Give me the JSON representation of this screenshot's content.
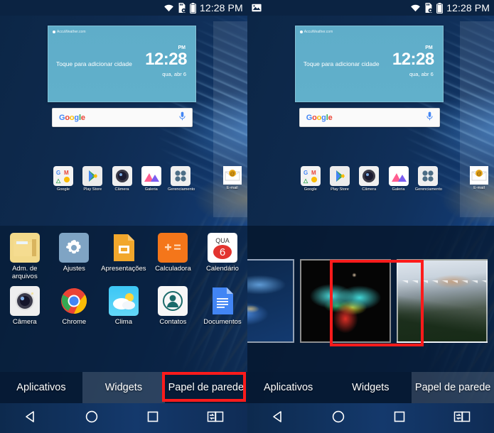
{
  "meta": {
    "accent_red": "#ff1b1b",
    "wallpaper_blue": "#10305b",
    "widget_blue": "#5fadc9"
  },
  "statusbar": {
    "time": "12:28 PM",
    "icons_right": [
      "wifi-icon",
      "sdcard-icon",
      "battery-icon"
    ],
    "icons_left_right_panel": [
      "image-notification-icon"
    ]
  },
  "home": {
    "weather_widget": {
      "provider": "AccuWeather.com",
      "prompt": "Toque para adicionar cidade",
      "ampm": "PM",
      "time": "12:28",
      "date": "qua, abr 6"
    },
    "search": {
      "logo": "Google",
      "mic_icon": "microphone-icon"
    },
    "dock": [
      {
        "label": "Google",
        "icon": "google-folder-icon"
      },
      {
        "label": "Play Store",
        "icon": "play-store-icon"
      },
      {
        "label": "Câmera",
        "icon": "camera-icon"
      },
      {
        "label": "Galeria",
        "icon": "gallery-icon"
      },
      {
        "label": "Gerenciamento",
        "icon": "management-folder-icon"
      }
    ],
    "side_app": {
      "label": "E-mail",
      "icon": "email-icon"
    }
  },
  "drawer": {
    "apps": [
      {
        "label": "Adm. de arquivos",
        "icon": "file-manager-icon"
      },
      {
        "label": "Ajustes",
        "icon": "settings-gear-icon"
      },
      {
        "label": "Apresentações",
        "icon": "slides-icon"
      },
      {
        "label": "Calculadora",
        "icon": "calculator-icon"
      },
      {
        "label": "Calendário",
        "icon": "calendar-icon",
        "day_name": "QUA",
        "day_number": "6"
      },
      {
        "label": "Câmera",
        "icon": "camera-icon"
      },
      {
        "label": "Chrome",
        "icon": "chrome-icon"
      },
      {
        "label": "Clima",
        "icon": "weather-icon"
      },
      {
        "label": "Contatos",
        "icon": "contacts-icon"
      },
      {
        "label": "Documentos",
        "icon": "docs-icon"
      }
    ]
  },
  "tabs": {
    "left": [
      {
        "label": "Aplicativos",
        "state": "active"
      },
      {
        "label": "Widgets",
        "state": "inactive"
      },
      {
        "label": "Papel de parede",
        "state": "highlighted"
      }
    ],
    "right": [
      {
        "label": "Aplicativos",
        "state": "inactive"
      },
      {
        "label": "Widgets",
        "state": "inactive"
      },
      {
        "label": "Papel de parede",
        "state": "active"
      }
    ]
  },
  "wallpaper_picker": {
    "thumbnails": [
      {
        "name": "blue-abstract-wallpaper",
        "selected": false
      },
      {
        "name": "colorful-bird-wings-wallpaper",
        "selected": true
      },
      {
        "name": "snowy-mountain-wallpaper",
        "selected": false
      }
    ]
  },
  "navbar": [
    {
      "label": "Voltar",
      "icon": "back-triangle-icon"
    },
    {
      "label": "Início",
      "icon": "home-circle-icon"
    },
    {
      "label": "Recentes",
      "icon": "recents-square-icon"
    },
    {
      "label": "Captura+",
      "icon": "dual-window-icon"
    }
  ]
}
